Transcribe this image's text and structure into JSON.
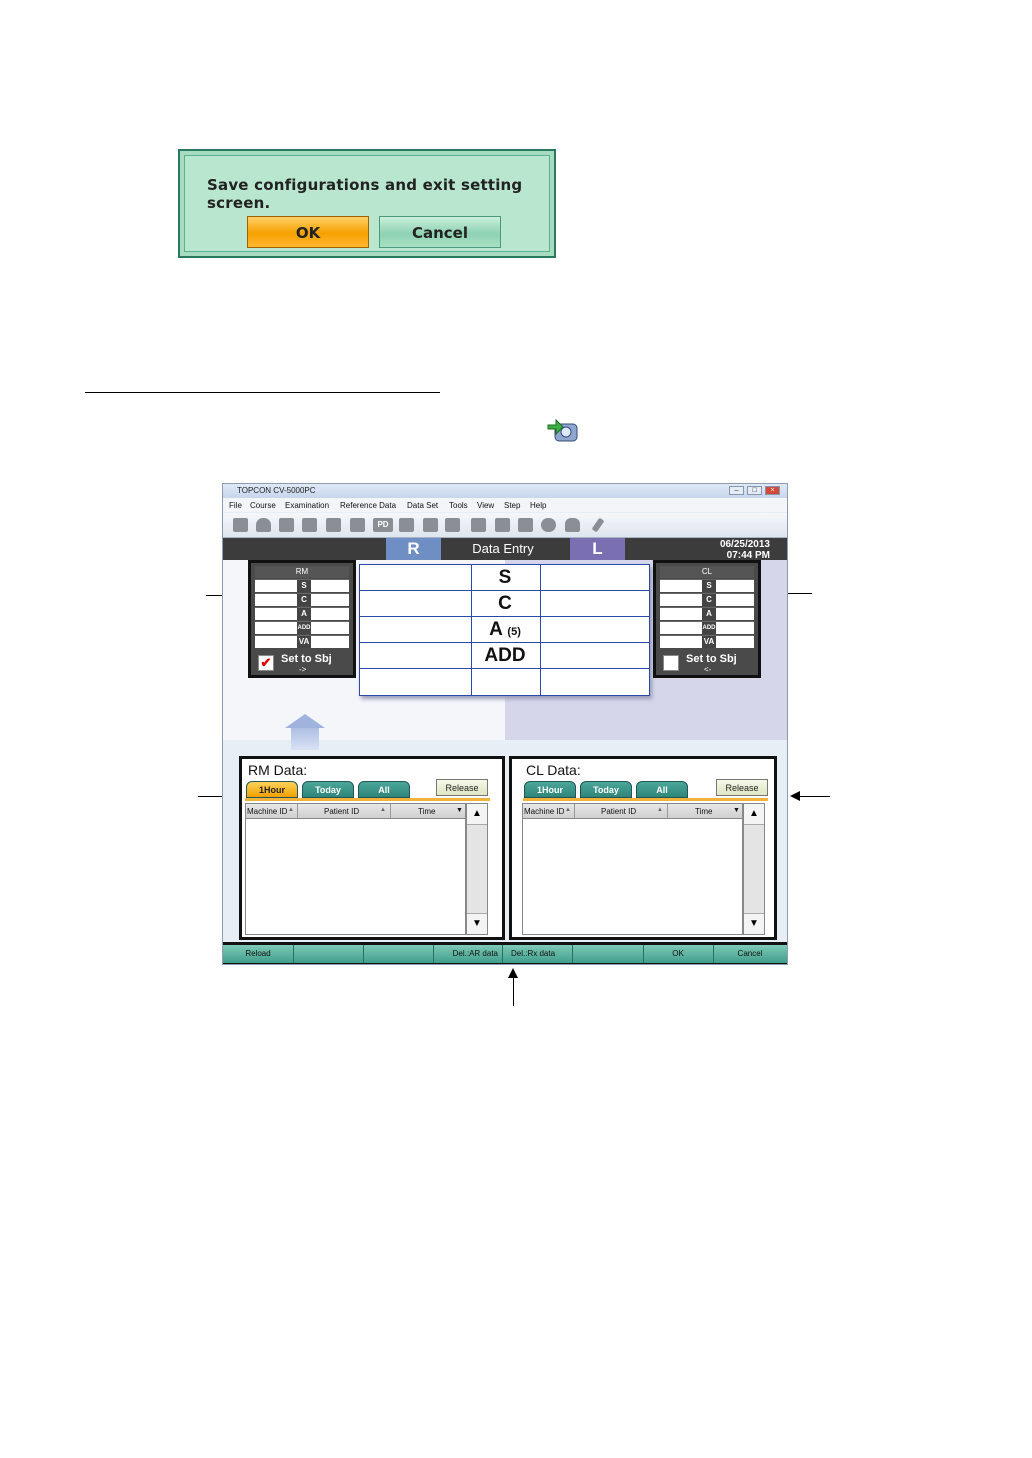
{
  "dialog": {
    "message": "Save configurations and exit setting screen.",
    "ok_label": "OK",
    "cancel_label": "Cancel"
  },
  "window": {
    "title": "TOPCON CV-5000PC",
    "menu": [
      "File",
      "Course",
      "Examination",
      "Reference Data",
      "Data Set",
      "Tools",
      "View",
      "Step",
      "Help"
    ],
    "toolbar_pd_label": "PD",
    "header": {
      "right_eye": "R",
      "title": "Data Entry",
      "left_eye": "L",
      "date": "06/25/2013",
      "time": "07:44 PM"
    },
    "grid": {
      "labels": [
        "S",
        "C",
        "A",
        "ADD"
      ],
      "a_suffix": "(5)"
    },
    "rm_panel": {
      "title": "RM",
      "rows": [
        "S",
        "C",
        "A",
        "ADD",
        "VA"
      ],
      "set_label": "Set to Sbj",
      "set_arrow": "->",
      "checked": true
    },
    "cl_panel": {
      "title": "CL",
      "rows": [
        "S",
        "C",
        "A",
        "ADD",
        "VA"
      ],
      "set_label": "Set to Sbj",
      "set_arrow": "<-",
      "checked": false
    },
    "rm_data": {
      "title": "RM Data:",
      "tabs": [
        "1Hour",
        "Today",
        "All"
      ],
      "release": "Release",
      "columns": [
        "Machine ID",
        "Patient ID",
        "Time"
      ]
    },
    "cl_data": {
      "title": "CL Data:",
      "tabs": [
        "1Hour",
        "Today",
        "All"
      ],
      "release": "Release",
      "columns": [
        "Machine ID",
        "Patient ID",
        "Time"
      ]
    },
    "bottom_bar": [
      "Reload",
      "",
      "",
      "Del.:AR data",
      "Del.:Rx data",
      "",
      "OK",
      "Cancel"
    ]
  },
  "colors": {
    "ok_button": "#f5a000",
    "dialog_bg": "#b9e6ce",
    "tab_active": "#f0a000",
    "tab": "#2f8578",
    "header_bg": "#3c3c3c"
  }
}
